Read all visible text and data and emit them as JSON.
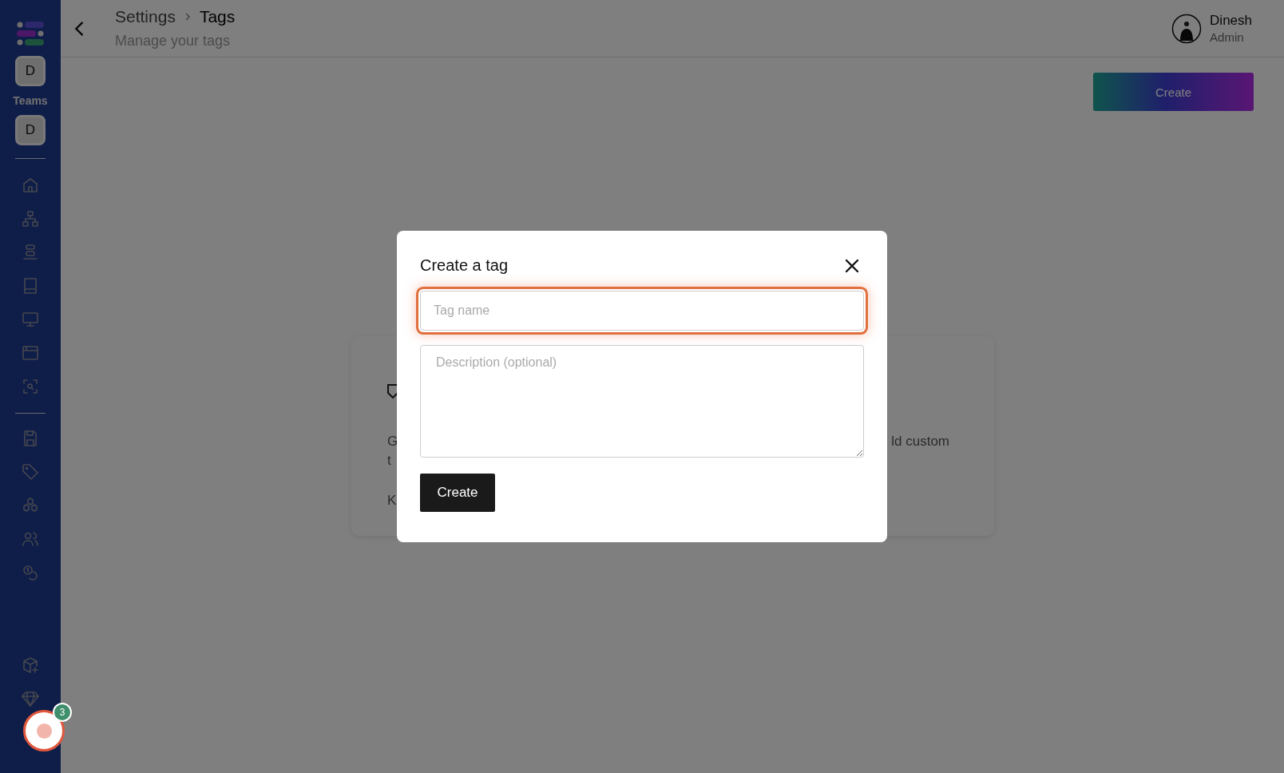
{
  "sidebar": {
    "team_avatars": [
      "D",
      "D"
    ],
    "teams_label": "Teams"
  },
  "header": {
    "breadcrumb": [
      "Settings",
      "Tags"
    ],
    "subtitle": "Manage your tags",
    "user": {
      "name": "Dinesh",
      "role": "Admin"
    }
  },
  "create_button": "Create",
  "card": {
    "lines_left": [
      "G",
      "t",
      "K"
    ],
    "line_right": "ld custom"
  },
  "modal": {
    "title": "Create a tag",
    "name_field": {
      "placeholder": "Tag name",
      "focused": true
    },
    "description_field": {
      "placeholder": "Description (optional)"
    },
    "submit": "Create"
  },
  "recorder": {
    "badge": "3"
  }
}
